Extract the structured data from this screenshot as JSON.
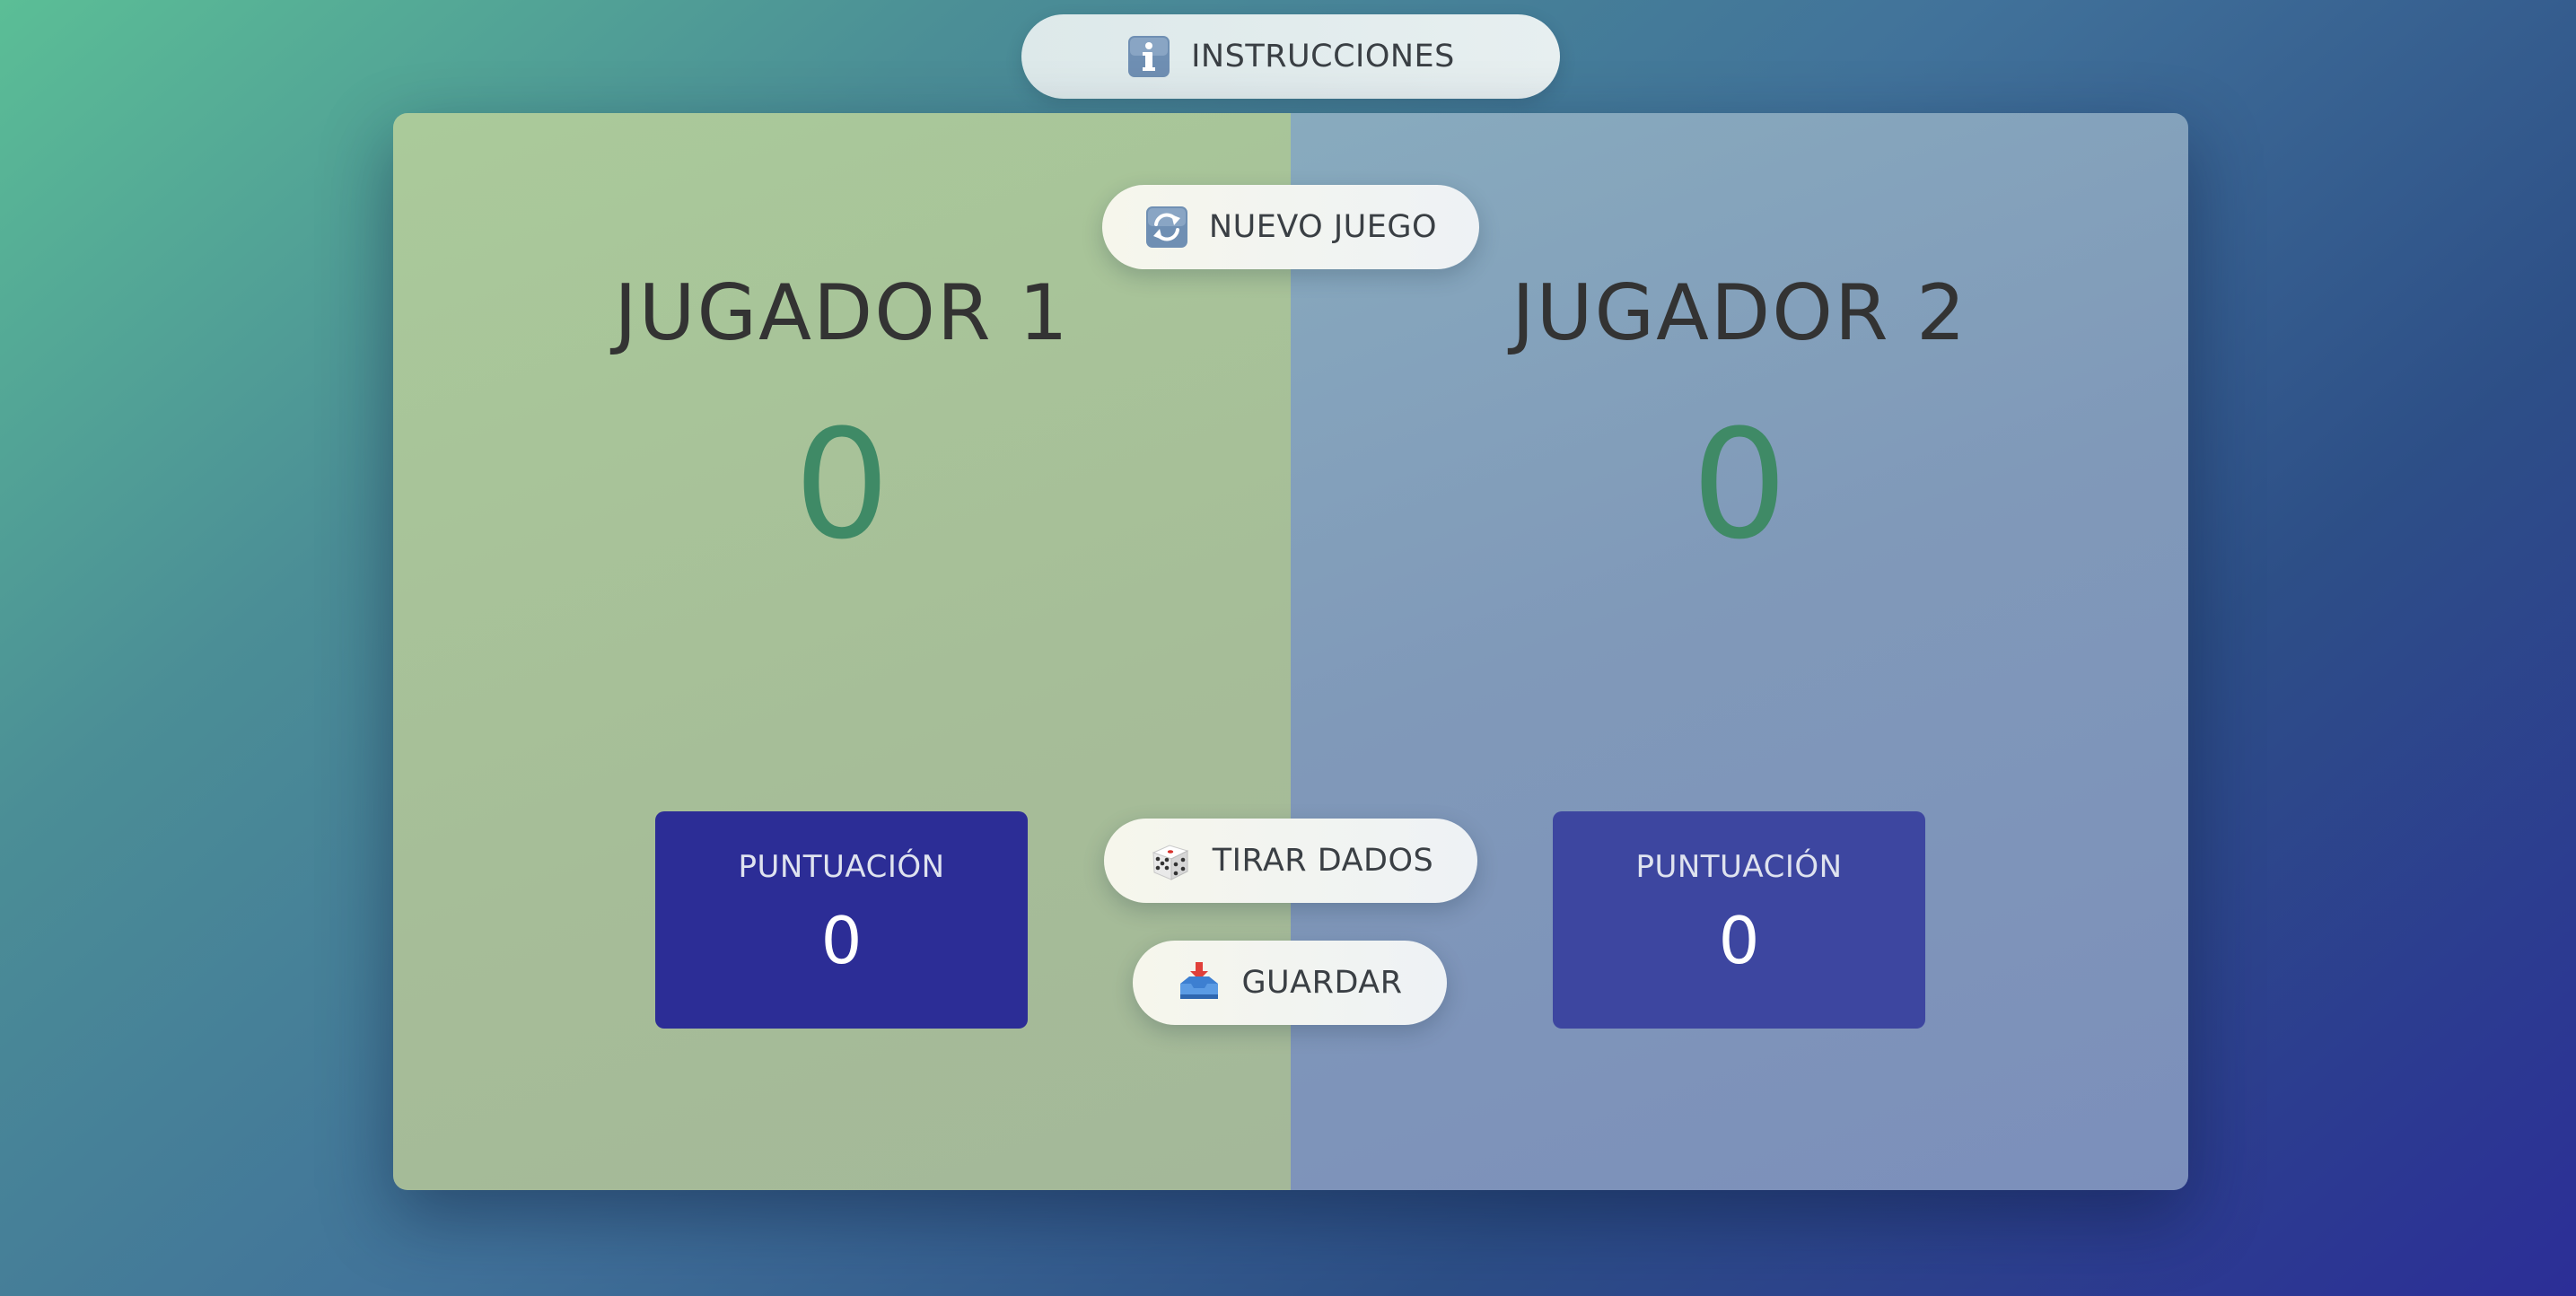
{
  "header": {
    "instructions_label": "INSTRUCCIONES",
    "instructions_icon": "info-icon"
  },
  "players": [
    {
      "name": "JUGADOR 1",
      "current": "0",
      "score_label": "PUNTUACIÓN",
      "score": "0"
    },
    {
      "name": "JUGADOR 2",
      "current": "0",
      "score_label": "PUNTUACIÓN",
      "score": "0"
    }
  ],
  "actions": {
    "new_game_label": "NUEVO JUEGO",
    "new_game_icon": "refresh-icon",
    "roll_label": "TIRAR DADOS",
    "roll_icon": "dice-icon",
    "save_label": "GUARDAR",
    "save_icon": "inbox-tray-icon"
  },
  "colors": {
    "player1_panel": "#aaca9a",
    "player2_panel": "#88abbe",
    "current_score": "#3f8a66",
    "score_box_player1": "#2c2d96",
    "score_box_player2": "#3d46a0"
  }
}
